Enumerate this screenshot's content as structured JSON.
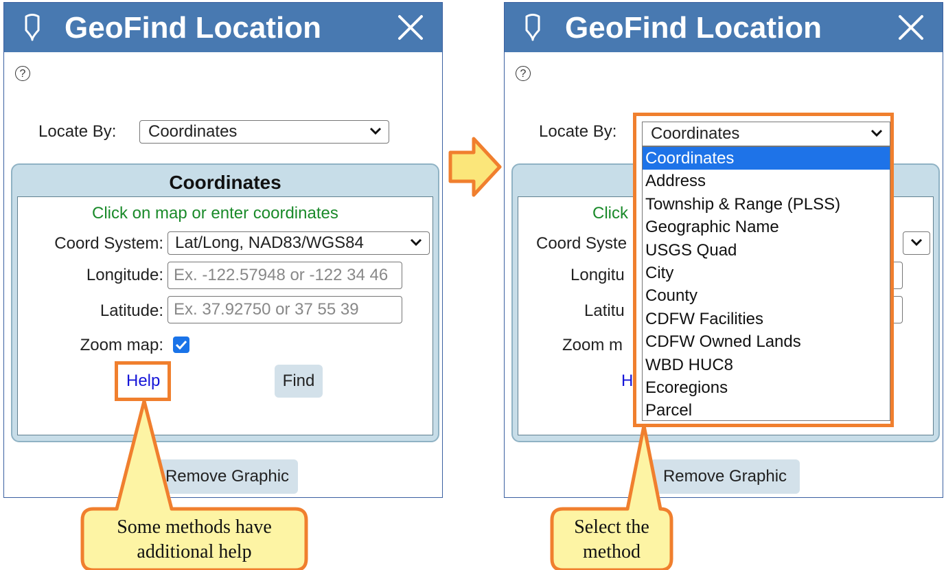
{
  "dialog": {
    "title": "GeoFind Location",
    "help_icon": "?"
  },
  "left": {
    "locate_by_label": "Locate By:",
    "locate_by_value": "Coordinates",
    "section_title": "Coordinates",
    "hint": "Click on map or enter coordinates",
    "coord_system_label": "Coord System:",
    "coord_system_value": "Lat/Long, NAD83/WGS84",
    "longitude_label": "Longitude:",
    "longitude_placeholder": "Ex. -122.57948 or -122 34 46",
    "latitude_label": "Latitude:",
    "latitude_placeholder": "Ex. 37.92750 or 37 55 39",
    "zoom_label": "Zoom map:",
    "zoom_checked": true,
    "help_link": "Help",
    "find_button": "Find",
    "remove_button": "Remove Graphic"
  },
  "right": {
    "locate_by_label": "Locate By:",
    "locate_by_value": "Coordinates",
    "hint_partial": "Click",
    "coord_system_partial": "Coord Syste",
    "longitude_partial": "Longitu",
    "latitude_partial": "Latitu",
    "zoom_partial": "Zoom m",
    "help_partial": "H",
    "remove_button": "Remove Graphic",
    "options": [
      "Coordinates",
      "Address",
      "Township & Range (PLSS)",
      "Geographic Name",
      "USGS Quad",
      "City",
      "County",
      "CDFW Facilities",
      "CDFW Owned Lands",
      "WBD HUC8",
      "Ecoregions",
      "Parcel"
    ],
    "selected_index": 0
  },
  "callouts": {
    "left": [
      "Some methods have",
      "additional help"
    ],
    "right": [
      "Select the",
      "method"
    ]
  },
  "colors": {
    "titlebar": "#4879b1",
    "highlight": "#f07f2e",
    "callout_fill": "#fdf4a4",
    "arrow_fill": "#fbe67a",
    "hint_green": "#1a8a2a",
    "link_blue": "#1515d8"
  }
}
